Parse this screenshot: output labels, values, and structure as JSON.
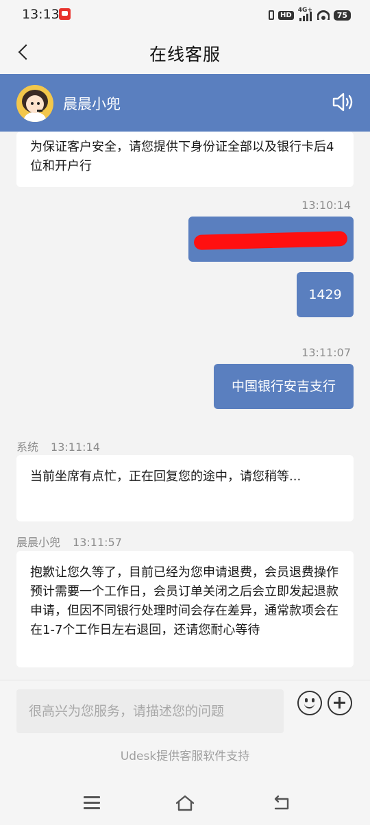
{
  "status_bar": {
    "time": "13:13",
    "hd": "HD",
    "network": "4G+",
    "battery": "75"
  },
  "nav": {
    "title": "在线客服"
  },
  "agent": {
    "name": "晨晨小兜"
  },
  "messages": {
    "m1_text": "为保证客户安全，请您提供下身份证全部以及银行卡后4位和开户行",
    "ts1": "13:10:14",
    "m3_text": "1429",
    "ts2": "13:11:07",
    "m4_text": "中国银行安吉支行",
    "sys_sender": "系统",
    "sys_time": "13:11:14",
    "sys_text": "当前坐席有点忙，正在回复您的途中，请您稍等...",
    "agent_sender": "晨晨小兜",
    "agent_time": "13:11:57",
    "agent_text": "抱歉让您久等了，目前已经为您申请退费，会员退费操作预计需要一个工作日，会员订单关闭之后会立即发起退款申请，但因不同银行处理时间会存在差异，通常款项会在在1-7个工作日左右退回，还请您耐心等待"
  },
  "input": {
    "placeholder": "很高兴为您服务，请描述您的问题",
    "value": ""
  },
  "footer": {
    "powered_by": "Udesk提供客服软件支持"
  },
  "colors": {
    "accent": "#5a7fbf",
    "background": "#f3f3f3",
    "redaction": "#ff1010"
  }
}
